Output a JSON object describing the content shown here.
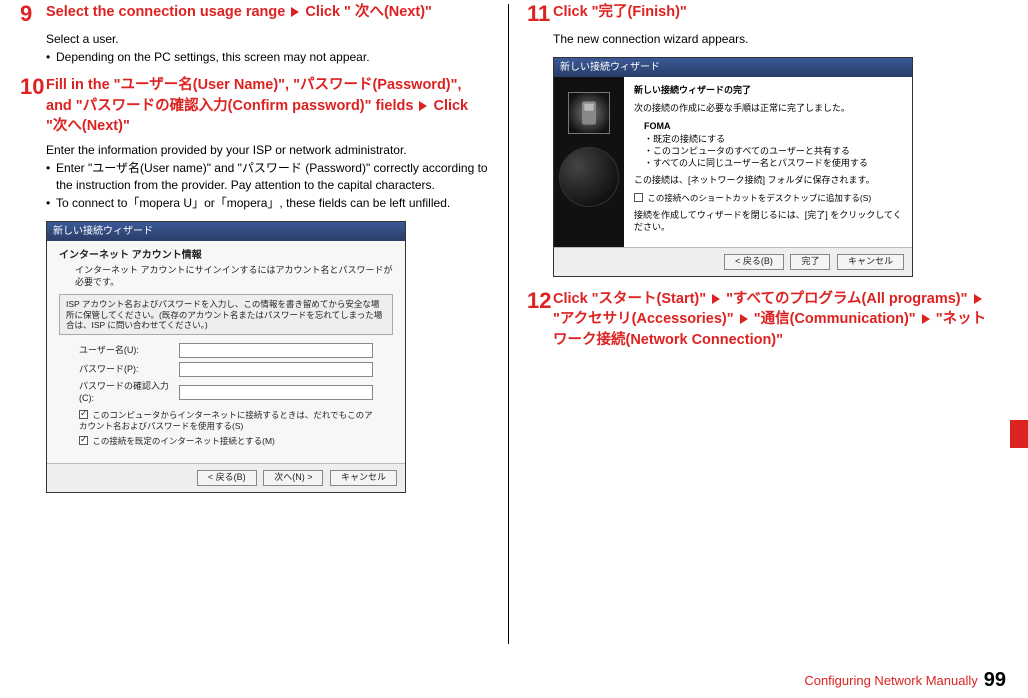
{
  "steps": {
    "s9": {
      "num": "9",
      "heading_a": "Select the connection usage range ",
      "heading_b": " Click \" 次へ(Next)\"",
      "body_line": "Select a user.",
      "bullet": " Depending on the PC settings, this screen may not appear."
    },
    "s10": {
      "num": "10",
      "heading": "Fill in the \"ユーザー名(User Name)\", \"パスワード(Password)\", and \"パスワードの確認入力(Confirm password)\" fields ",
      "heading_b": " Click \"次へ(Next)\"",
      "body_line": "Enter the information provided by your ISP or network administrator.",
      "bullet1": "Enter \"ユーザ名(User name)\" and \"パスワード (Password)\" correctly according to the instruction from the provider. Pay attention to the capital characters.",
      "bullet2": "To connect to「mopera U」or「mopera」, these fields can be left unfilled."
    },
    "s11": {
      "num": "11",
      "heading": "Click \"完了(Finish)\"",
      "body": "The new connection wizard appears."
    },
    "s12": {
      "num": "12",
      "heading_a": "Click \"スタート(Start)\" ",
      "heading_b": " \"すべてのプログラム(All programs)\" ",
      "heading_c": " \"アクセサリ(Accessories)\" ",
      "heading_d": " \"通信(Communication)\" ",
      "heading_e": " \"ネットワーク接続(Network Connection)\""
    }
  },
  "screenshot10": {
    "title": "新しい接続ウィザード",
    "heading": "インターネット アカウント情報",
    "sub": "インターネット アカウントにサインインするにはアカウント名とパスワードが必要です。",
    "note": "ISP アカウント名およびパスワードを入力し、この情報を書き留めてから安全な場所に保管してください。(既存のアカウント名またはパスワードを忘れてしまった場合は、ISP に問い合わせてください。)",
    "f1": "ユーザー名(U):",
    "f2": "パスワード(P):",
    "f3": "パスワードの確認入力(C):",
    "chk1": "このコンピュータからインターネットに接続するときは、だれでもこのアカウント名およびパスワードを使用する(S)",
    "chk2": "この接続を既定のインターネット接続とする(M)",
    "btn_back": "< 戻る(B)",
    "btn_next": "次へ(N) >",
    "btn_cancel": "キャンセル"
  },
  "screenshot11": {
    "title": "新しい接続ウィザード",
    "heading": "新しい接続ウィザードの完了",
    "sub": "次の接続の作成に必要な手順は正常に完了しました。",
    "group": "FOMA",
    "b1": "既定の接続にする",
    "b2": "このコンピュータのすべてのユーザーと共有する",
    "b3": "すべての人に同じユーザー名とパスワードを使用する",
    "line2": "この接続は、[ネットワーク接続] フォルダに保存されます。",
    "chk": "この接続へのショートカットをデスクトップに追加する(S)",
    "line3": "接続を作成してウィザードを閉じるには、[完了] をクリックしてください。",
    "btn_back": "< 戻る(B)",
    "btn_finish": "完了",
    "btn_cancel": "キャンセル"
  },
  "footer": {
    "text": "Configuring Network Manually",
    "page": "99"
  }
}
